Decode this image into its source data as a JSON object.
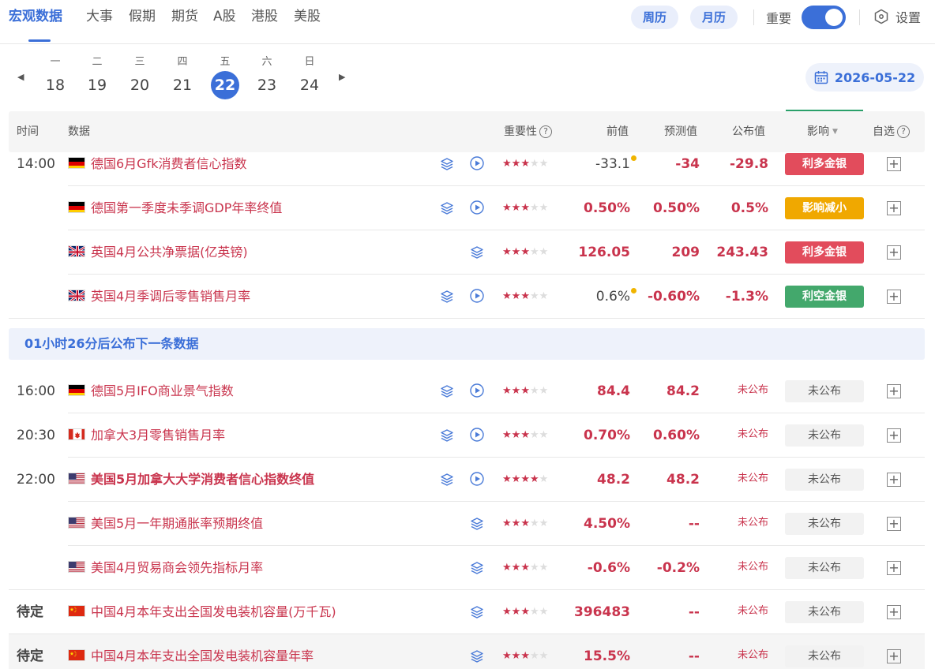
{
  "nav": {
    "tabs": [
      "宏观数据",
      "大事",
      "假期",
      "期货",
      "A股",
      "港股",
      "美股"
    ],
    "week_btn": "周历",
    "month_btn": "月历",
    "toggle_label": "重要",
    "toggle_on": true,
    "settings": "设置"
  },
  "dates": {
    "weekdays": [
      "一",
      "二",
      "三",
      "四",
      "五",
      "六",
      "日"
    ],
    "days": [
      "18",
      "19",
      "20",
      "21",
      "22",
      "23",
      "24"
    ],
    "selected": "22",
    "current_date": "2026-05-22"
  },
  "table": {
    "headers": {
      "time": "时间",
      "data": "数据",
      "importance": "重要性",
      "prev": "前值",
      "forecast": "预测值",
      "actual": "公布值",
      "impact": "影响",
      "watch": "自选"
    },
    "banner": "01小时26分后公布下一条数据",
    "rows": [
      {
        "time": "14:00",
        "flag": "de",
        "name": "德国6月Gfk消费者信心指数",
        "stars": 3,
        "prev": "-33.1",
        "prev_dot": true,
        "forecast": "-34",
        "actual": "-29.8",
        "impact": "利多金银",
        "impact_type": "red",
        "play": true
      },
      {
        "time": "",
        "flag": "de",
        "name": "德国第一季度未季调GDP年率终值",
        "stars": 3,
        "prev": "0.50%",
        "forecast": "0.50%",
        "actual": "0.5%",
        "impact": "影响减小",
        "impact_type": "orange",
        "play": true
      },
      {
        "time": "",
        "flag": "gb",
        "name": "英国4月公共净票据(亿英镑)",
        "stars": 3,
        "prev": "126.05",
        "forecast": "209",
        "actual": "243.43",
        "impact": "利多金银",
        "impact_type": "red",
        "play": false
      },
      {
        "time": "",
        "flag": "gb",
        "name": "英国4月季调后零售销售月率",
        "stars": 3,
        "prev": "0.6%",
        "prev_dot": true,
        "forecast": "-0.60%",
        "actual": "-1.3%",
        "impact": "利空金银",
        "impact_type": "green",
        "play": true
      },
      {
        "time": "16:00",
        "flag": "de",
        "name": "德国5月IFO商业景气指数",
        "stars": 3,
        "prev": "84.4",
        "forecast": "84.2",
        "actual": "未公布",
        "impact": "未公布",
        "impact_type": "grey",
        "play": true
      },
      {
        "time": "20:30",
        "flag": "ca",
        "name": "加拿大3月零售销售月率",
        "stars": 3,
        "prev": "0.70%",
        "forecast": "0.60%",
        "actual": "未公布",
        "impact": "未公布",
        "impact_type": "grey",
        "play": true
      },
      {
        "time": "22:00",
        "flag": "us",
        "name": "美国5月加拿大大学消费者信心指数终值",
        "stars": 4,
        "prev": "48.2",
        "forecast": "48.2",
        "actual": "未公布",
        "impact": "未公布",
        "impact_type": "grey",
        "play": true,
        "bold": true
      },
      {
        "time": "",
        "flag": "us",
        "name": "美国5月一年期通胀率预期终值",
        "stars": 3,
        "prev": "4.50%",
        "forecast": "--",
        "actual": "未公布",
        "impact": "未公布",
        "impact_type": "grey",
        "play": false
      },
      {
        "time": "",
        "flag": "us",
        "name": "美国4月贸易商会领先指标月率",
        "stars": 3,
        "prev": "-0.6%",
        "forecast": "-0.2%",
        "actual": "未公布",
        "impact": "未公布",
        "impact_type": "grey",
        "play": false
      },
      {
        "time": "待定",
        "flag": "cn",
        "name": "中国4月本年支出全国发电装机容量(万千瓦)",
        "stars": 3,
        "prev": "396483",
        "forecast": "--",
        "actual": "未公布",
        "impact": "未公布",
        "impact_type": "grey",
        "play": false
      },
      {
        "time": "待定",
        "flag": "cn",
        "name": "中国4月本年支出全国发电装机容量年率",
        "stars": 3,
        "prev": "15.5%",
        "forecast": "--",
        "actual": "未公布",
        "impact": "未公布",
        "impact_type": "grey",
        "play": false
      }
    ]
  },
  "colors": {
    "accent": "#3b6fd8",
    "red": "#c9344d",
    "badge_red": "#e24c5c",
    "badge_orange": "#f0a800",
    "badge_green": "#43a86c"
  }
}
